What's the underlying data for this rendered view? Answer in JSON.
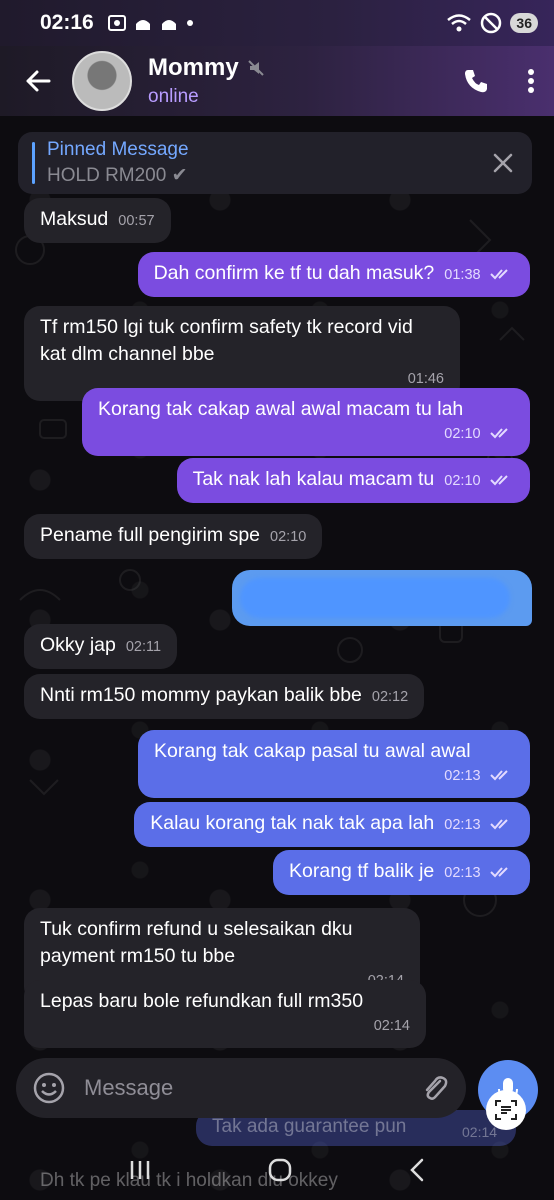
{
  "status_bar": {
    "time": "02:16",
    "battery": "36",
    "left_icons": [
      "screenshot-icon",
      "mosque-icon",
      "mosque-icon",
      "dot-icon"
    ],
    "right_icons": [
      "wifi-icon",
      "do-not-disturb-icon"
    ]
  },
  "header": {
    "name": "Mommy",
    "status": "online",
    "muted": true
  },
  "pinned": {
    "title": "Pinned Message",
    "text": "HOLD RM200 ✔"
  },
  "messages": [
    {
      "dir": "in",
      "text": "Maksud",
      "time": "00:57"
    },
    {
      "dir": "out",
      "text": "Dah confirm ke tf tu dah masuk?",
      "time": "01:38"
    },
    {
      "dir": "in",
      "text": "Tf rm150 lgi tuk confirm safety tk record vid kat dlm channel bbe",
      "time": "01:46"
    },
    {
      "dir": "out",
      "text": "Korang tak cakap awal awal macam tu lah",
      "time": "02:10"
    },
    {
      "dir": "out",
      "text": "Tak nak lah kalau macam tu",
      "time": "02:10"
    },
    {
      "dir": "in",
      "text": "Pename full pengirim spe",
      "time": "02:10"
    },
    {
      "dir": "in",
      "text": "Okky jap",
      "time": "02:11"
    },
    {
      "dir": "in",
      "text": "Nnti rm150 mommy paykan balik bbe",
      "time": "02:12"
    },
    {
      "dir": "out",
      "text": "Korang tak cakap pasal tu awal awal",
      "time": "02:13"
    },
    {
      "dir": "out",
      "text": "Kalau korang tak nak tak apa lah",
      "time": "02:13"
    },
    {
      "dir": "out",
      "text": "Korang tf balik je",
      "time": "02:13"
    },
    {
      "dir": "in",
      "text": "Tuk confirm refund u selesaikan dku payment rm150 tu bbe",
      "time": "02:14"
    },
    {
      "dir": "in",
      "text": "Lepas baru bole refundkan full rm350",
      "time": "02:14"
    }
  ],
  "input": {
    "placeholder": "Message"
  },
  "ghost_messages": {
    "out_text": "Tak ada guarantee pun",
    "out_time": "02:14",
    "in_text": "Dh tk pe klau tk i holdkan dlu okkey"
  },
  "colors": {
    "accent": "#7b4ce0",
    "accent_blue": "#5b6ee8",
    "incoming": "#242329",
    "link": "#74a8ff"
  }
}
